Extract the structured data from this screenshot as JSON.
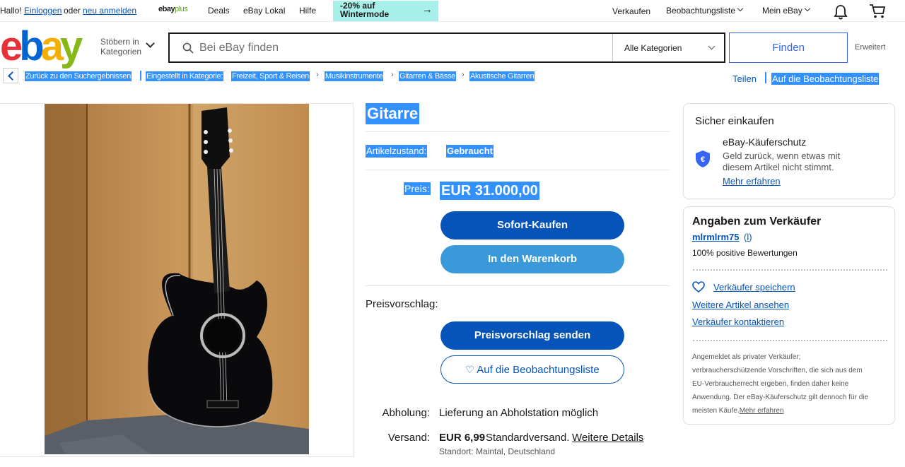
{
  "topbar": {
    "greeting": "Hallo!",
    "login": "Einloggen",
    "or": "oder",
    "register": "neu anmelden",
    "ebayplus_a": "ebay",
    "ebayplus_b": "plus",
    "deals": "Deals",
    "local": "eBay Lokal",
    "help": "Hilfe",
    "promo_line1": "-20% auf",
    "promo_line2": "Wintermode",
    "sell": "Verkaufen",
    "watchlist": "Beobachtungsliste",
    "my_ebay": "Mein eBay"
  },
  "header": {
    "logo": [
      "e",
      "b",
      "a",
      "y"
    ],
    "browse_line1": "Stöbern in",
    "browse_line2": "Kategorien",
    "search_placeholder": "Bei eBay finden",
    "category_select": "Alle Kategorien",
    "search_button": "Finden",
    "advanced": "Erweitert"
  },
  "breadcrumb": {
    "back": "Zurück zu den Suchergebnissen",
    "listed_in": "Eingestellt in Kategorie:",
    "items": [
      "Freizeit, Sport & Reisen",
      "Musikinstrumente",
      "Gitarren & Bässe",
      "Akustische Gitarren"
    ],
    "share": "Teilen",
    "add_watch": "Auf die Beobachtungsliste"
  },
  "listing": {
    "title": "Gitarre",
    "condition_label": "Artikelzustand:",
    "condition_value": "Gebraucht",
    "price_label": "Preis:",
    "price": "EUR 31.000,00",
    "buy_now": "Sofort-Kaufen",
    "add_cart": "In den Warenkorb",
    "offer_label": "Preisvorschlag:",
    "send_offer": "Preisvorschlag senden",
    "watch": "Auf die Beobachtungsliste",
    "pickup_label": "Abholung:",
    "pickup_value": "Lieferung an Abholstation möglich",
    "shipping_label": "Versand:",
    "shipping_price": "EUR 6,99",
    "shipping_type": "Standardversand.",
    "shipping_details": "Weitere Details",
    "location": "Standort: Maintal, Deutschland"
  },
  "protection": {
    "heading": "Sicher einkaufen",
    "title": "eBay-Käuferschutz",
    "desc_line1": "Geld zurück, wenn etwas mit",
    "desc_line2": "diesem Artikel nicht stimmt.",
    "more": "Mehr erfahren"
  },
  "seller": {
    "heading": "Angaben zum Verkäufer",
    "name": "mlrmlrm75",
    "feedback_count": "(",
    "feedback_num": "l",
    "feedback_close": ")",
    "positive": "100% positive Bewertungen",
    "save": "Verkäufer speichern",
    "more_items": "Weitere Artikel ansehen",
    "contact": "Verkäufer kontaktieren",
    "note_line1": "Angemeldet als privater Verkäufer;",
    "note_line2": "verbraucherschützende Vorschriften, die sich aus dem",
    "note_line3": "EU-Verbraucherrecht ergeben, finden daher keine",
    "note_line4": "Anwendung. Der eBay-Käuferschutz gilt dennoch für die",
    "note_line5": "meisten Käufe.",
    "note_more": "Mehr erfahren"
  },
  "colors": {
    "primary": "#0654ba",
    "highlight": "#3390ff",
    "promo": "#a7f0e9"
  }
}
